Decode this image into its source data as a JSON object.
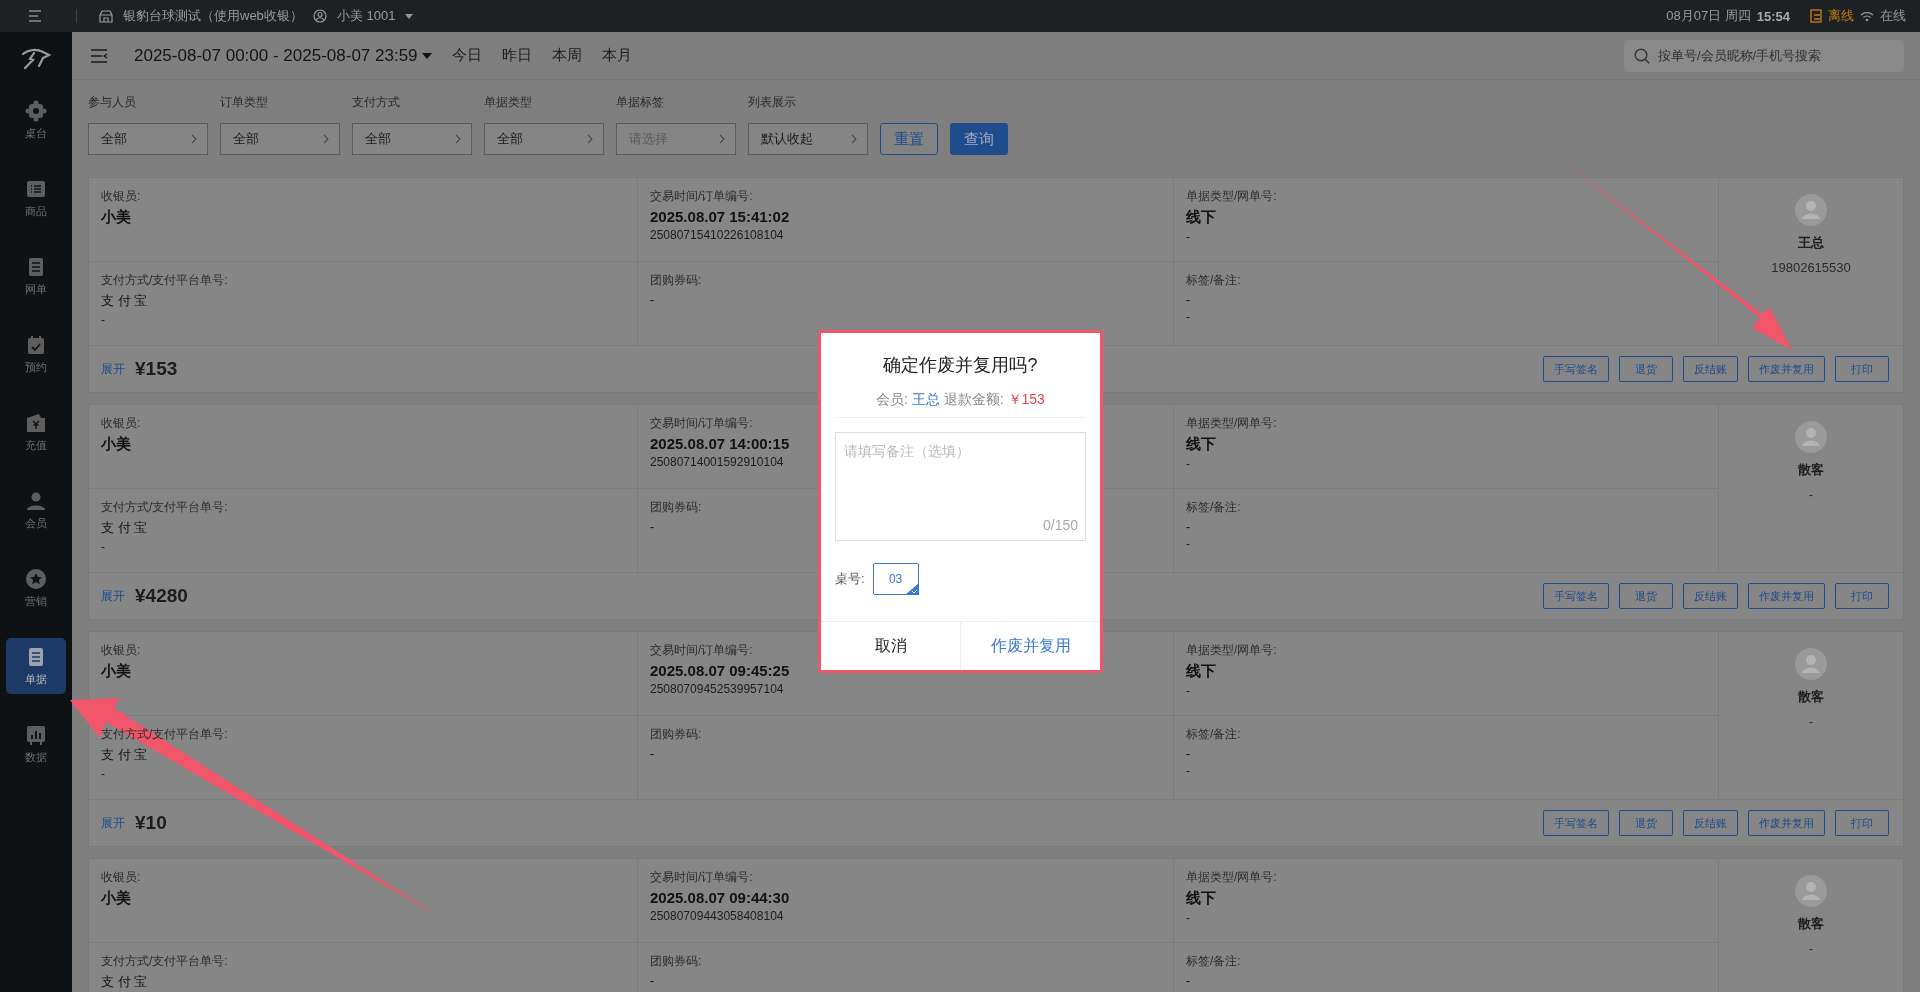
{
  "topbar": {
    "store": "银豹台球测试（使用web收银）",
    "user": "小美 1001",
    "date": "08月07日 周四",
    "time": "15:54",
    "offline": "离线",
    "online": "在线"
  },
  "sidebar": {
    "items": [
      {
        "kind": "table",
        "label": "桌台",
        "selected": false
      },
      {
        "kind": "goods",
        "label": "商品",
        "selected": false
      },
      {
        "kind": "doc",
        "label": "网单",
        "selected": false
      },
      {
        "kind": "calendar",
        "label": "预约",
        "selected": false
      },
      {
        "kind": "wallet",
        "label": "充值",
        "selected": false
      },
      {
        "kind": "person",
        "label": "会员",
        "selected": false
      },
      {
        "kind": "star",
        "label": "营销",
        "selected": false
      },
      {
        "kind": "doc",
        "label": "单据",
        "selected": true
      },
      {
        "kind": "chart",
        "label": "数据",
        "selected": false
      }
    ]
  },
  "header": {
    "date_range": "2025-08-07 00:00 - 2025-08-07 23:59",
    "quick": [
      "今日",
      "昨日",
      "本周",
      "本月"
    ],
    "search": {
      "placeholder": "按单号/会员昵称/手机号搜索"
    }
  },
  "filters": [
    {
      "label": "参与人员",
      "value": "全部"
    },
    {
      "label": "订单类型",
      "value": "全部"
    },
    {
      "label": "支付方式",
      "value": "全部"
    },
    {
      "label": "单据类型",
      "value": "全部"
    },
    {
      "label": "单据标签",
      "placeholder": "请选择"
    },
    {
      "label": "列表展示",
      "value": "默认收起"
    }
  ],
  "filter_buttons": {
    "reset": "重置",
    "query": "查询"
  },
  "orders": [
    {
      "rows": [
        [
          {
            "label": "收银员:",
            "lines": [
              "小美"
            ]
          },
          {
            "label": "交易时间/订单编号:",
            "lines": [
              "2025.08.07 15:41:02",
              "25080715410226108104"
            ]
          },
          {
            "label": "单据类型/网单号:",
            "lines": [
              "线下",
              "-"
            ]
          }
        ],
        [
          {
            "label": "支付方式/支付平台单号:",
            "lines": [
              "支 付 宝",
              "-"
            ]
          },
          {
            "label": "团购券码:",
            "lines": [
              "-"
            ]
          },
          {
            "label": "标签/备注:",
            "lines": [
              "-",
              "-"
            ]
          }
        ]
      ],
      "member": {
        "name": "王总",
        "phone": "19802615530"
      },
      "expand": "展开",
      "amount": "¥153",
      "actions": [
        "手写签名",
        "退货",
        "反结账",
        "作废并复用",
        "打印"
      ]
    },
    {
      "rows": [
        [
          {
            "label": "收银员:",
            "lines": [
              "小美"
            ]
          },
          {
            "label": "交易时间/订单编号:",
            "lines": [
              "2025.08.07 14:00:15",
              "25080714001592910104"
            ]
          },
          {
            "label": "单据类型/网单号:",
            "lines": [
              "线下",
              "-"
            ]
          }
        ],
        [
          {
            "label": "支付方式/支付平台单号:",
            "lines": [
              "支 付 宝",
              "-"
            ]
          },
          {
            "label": "团购券码:",
            "lines": [
              "-"
            ]
          },
          {
            "label": "标签/备注:",
            "lines": [
              "-",
              "-"
            ]
          }
        ]
      ],
      "member": {
        "name": "散客",
        "phone": "-"
      },
      "expand": "展开",
      "amount": "¥4280",
      "actions": [
        "手写签名",
        "退货",
        "反结账",
        "作废并复用",
        "打印"
      ]
    },
    {
      "rows": [
        [
          {
            "label": "收银员:",
            "lines": [
              "小美"
            ]
          },
          {
            "label": "交易时间/订单编号:",
            "lines": [
              "2025.08.07 09:45:25",
              "25080709452539957104"
            ]
          },
          {
            "label": "单据类型/网单号:",
            "lines": [
              "线下",
              "-"
            ]
          }
        ],
        [
          {
            "label": "支付方式/支付平台单号:",
            "lines": [
              "支 付 宝",
              "-"
            ]
          },
          {
            "label": "团购券码:",
            "lines": [
              "-"
            ]
          },
          {
            "label": "标签/备注:",
            "lines": [
              "-",
              "-"
            ]
          }
        ]
      ],
      "member": {
        "name": "散客",
        "phone": "-"
      },
      "expand": "展开",
      "amount": "¥10",
      "actions": [
        "手写签名",
        "退货",
        "反结账",
        "作废并复用",
        "打印"
      ]
    },
    {
      "rows": [
        [
          {
            "label": "收银员:",
            "lines": [
              "小美"
            ]
          },
          {
            "label": "交易时间/订单编号:",
            "lines": [
              "2025.08.07 09:44:30",
              "25080709443058408104"
            ]
          },
          {
            "label": "单据类型/网单号:",
            "lines": [
              "线下",
              "-"
            ]
          }
        ],
        [
          {
            "label": "支付方式/支付平台单号:",
            "lines": [
              "支 付 宝"
            ]
          },
          {
            "label": "团购券码:",
            "lines": [
              "-"
            ]
          },
          {
            "label": "标签/备注:",
            "lines": [
              "-"
            ]
          }
        ]
      ],
      "member": {
        "name": "散客",
        "phone": "-"
      }
    }
  ],
  "dialog": {
    "title": "确定作废并复用吗?",
    "member_label": "会员:",
    "member": "王总",
    "refund_label": "退款金额:",
    "refund": "￥153",
    "note": {
      "placeholder": "请填写备注（选填）"
    },
    "counter": "0/150",
    "table_label": "桌号:",
    "tables": [
      {
        "label": "03",
        "selected": true
      }
    ],
    "cancel": "取消",
    "confirm": "作废并复用"
  }
}
